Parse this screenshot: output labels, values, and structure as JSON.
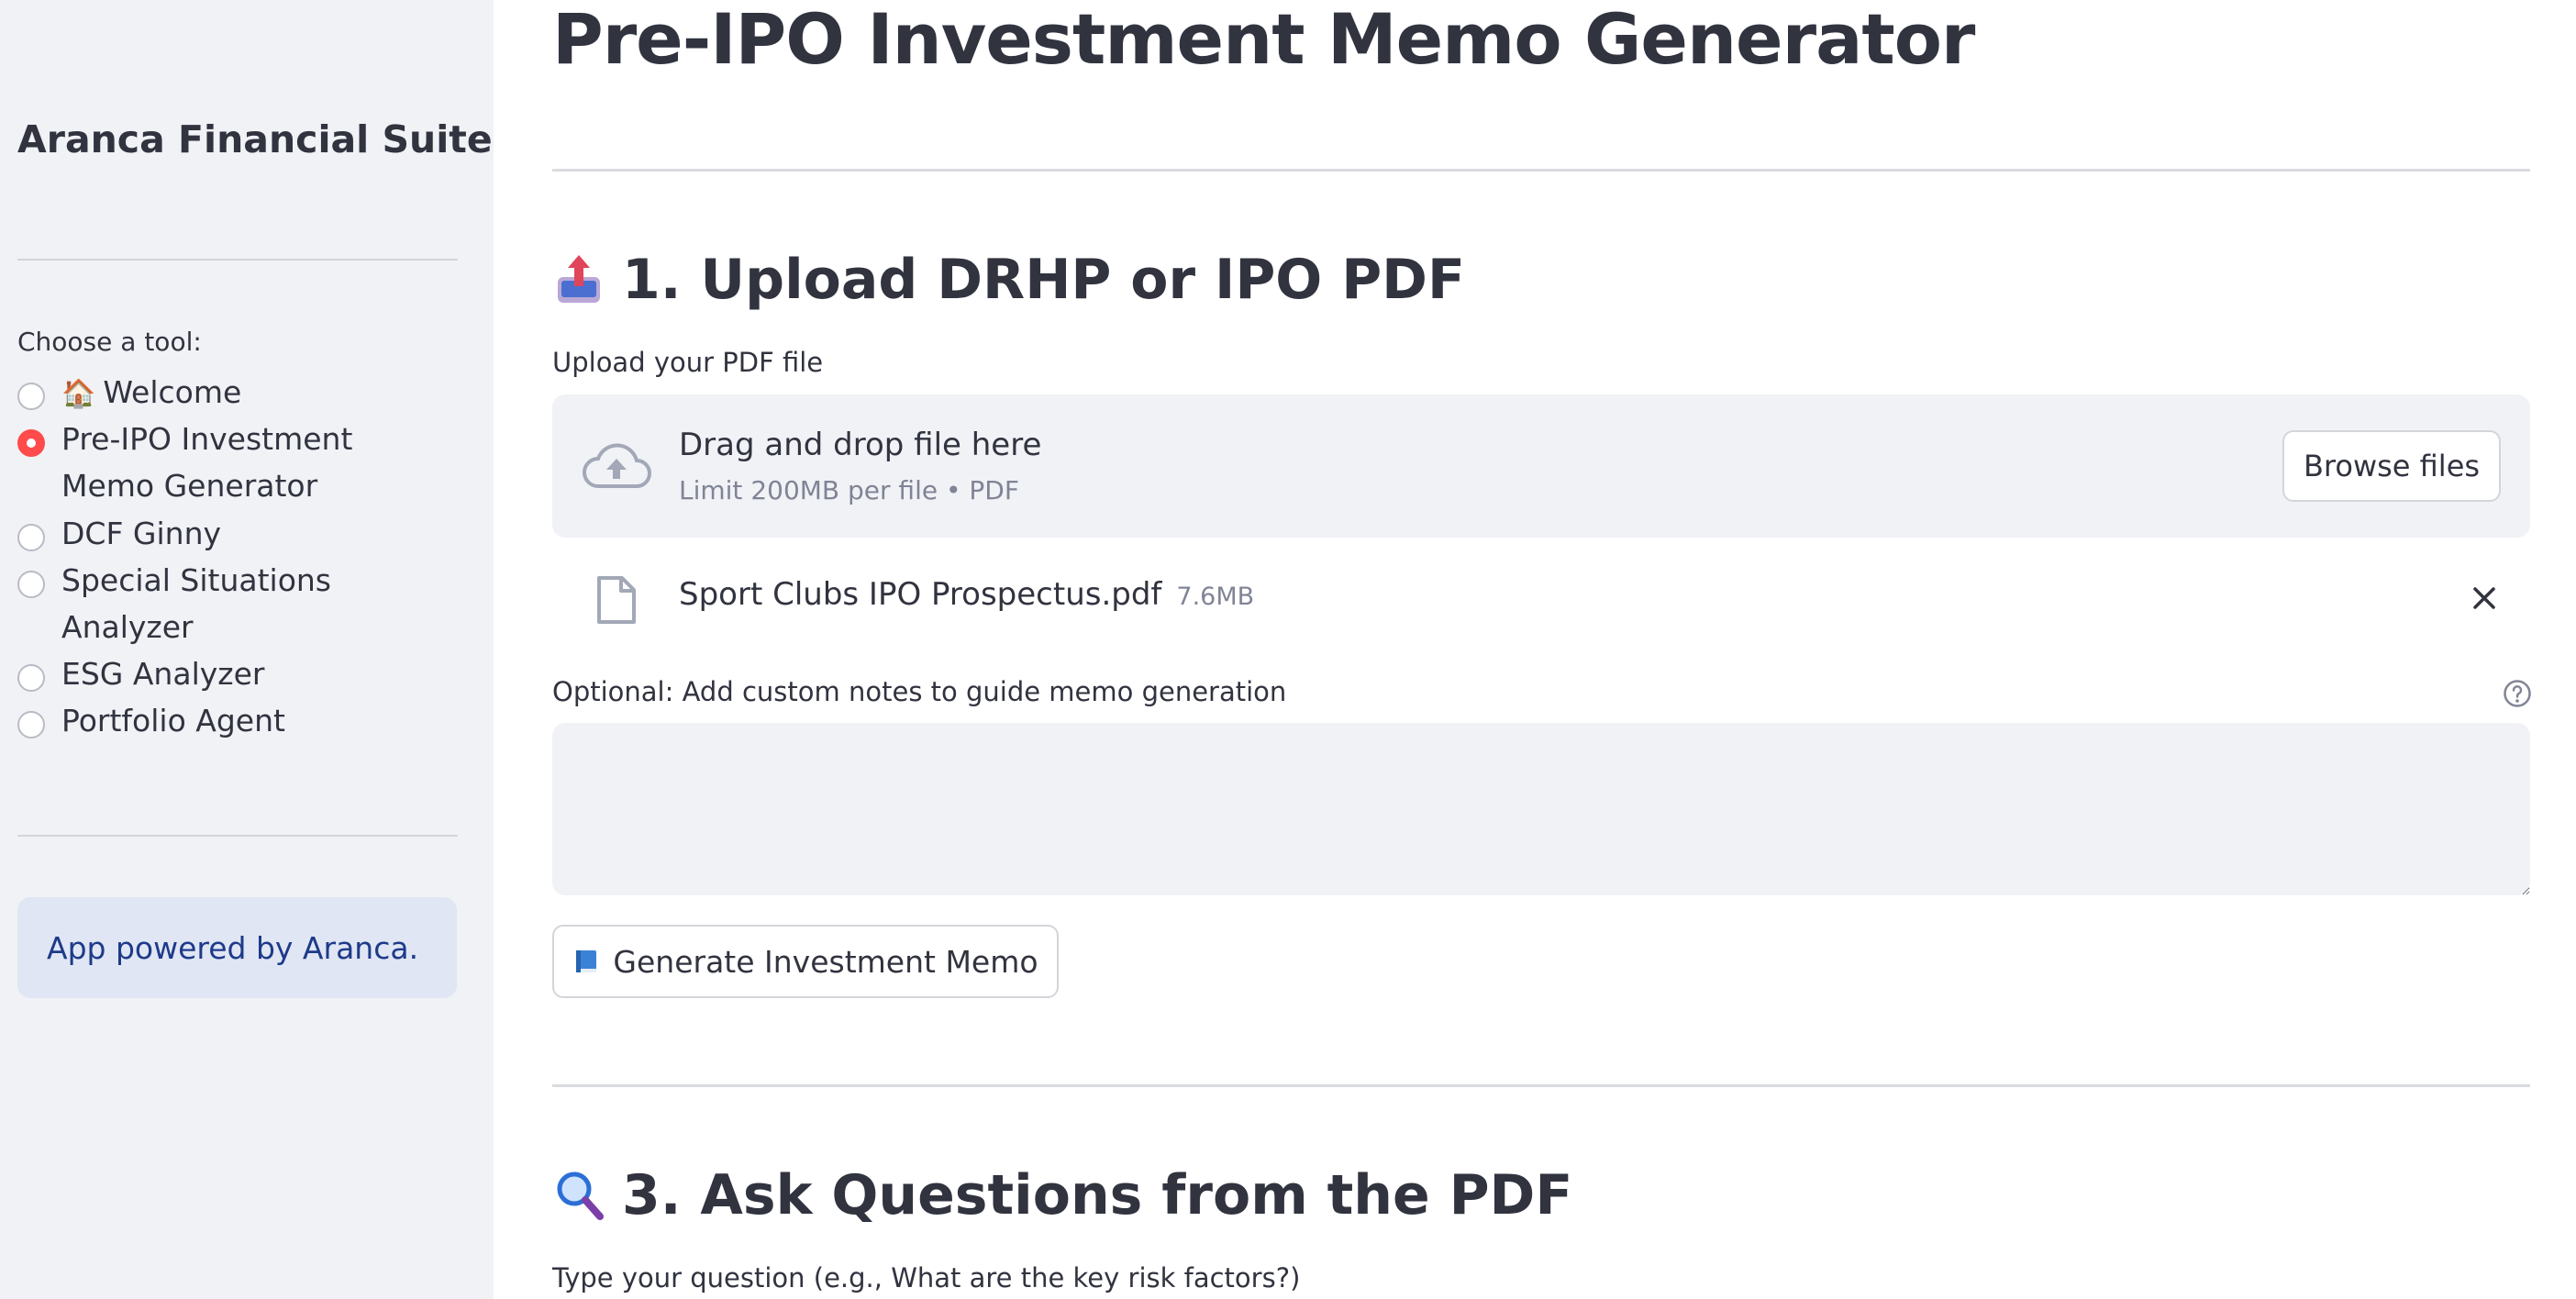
{
  "sidebar": {
    "app_title": "Aranca Financial Suite",
    "tool_label": "Choose a tool:",
    "tools": [
      {
        "emoji": "🏠",
        "label": "Welcome",
        "selected": false
      },
      {
        "emoji": "",
        "label": "Pre-IPO Investment Memo Generator",
        "selected": true
      },
      {
        "emoji": "",
        "label": "DCF Ginny",
        "selected": false
      },
      {
        "emoji": "",
        "label": "Special Situations Analyzer",
        "selected": false
      },
      {
        "emoji": "",
        "label": "ESG Analyzer",
        "selected": false
      },
      {
        "emoji": "",
        "label": "Portfolio Agent",
        "selected": false
      }
    ],
    "powered_by": "App powered by Aranca."
  },
  "main": {
    "title": "Pre-IPO Investment Memo Generator",
    "upload_section": {
      "header": "1. Upload DRHP or IPO PDF",
      "icon": "outbox-tray-icon",
      "label": "Upload your PDF file",
      "dropzone_title": "Drag and drop file here",
      "dropzone_sub": "Limit 200MB per file • PDF",
      "browse_label": "Browse files",
      "file": {
        "name": "Sport Clubs IPO Prospectus.pdf",
        "size": "7.6MB"
      }
    },
    "notes": {
      "label": "Optional: Add custom notes to guide memo generation",
      "value": "",
      "placeholder": ""
    },
    "generate_label": "Generate Investment Memo",
    "ask_section": {
      "header": "3. Ask Questions from the PDF",
      "icon": "magnifying-glass-icon",
      "label": "Type your question (e.g., What are the key risk factors?)"
    }
  },
  "colors": {
    "sidebar_bg": "#f0f2f6",
    "accent": "#ff4b4b",
    "info_bg": "#e0e6f3",
    "info_text": "#1e3a8a",
    "text": "#31333f",
    "muted": "#808495"
  }
}
